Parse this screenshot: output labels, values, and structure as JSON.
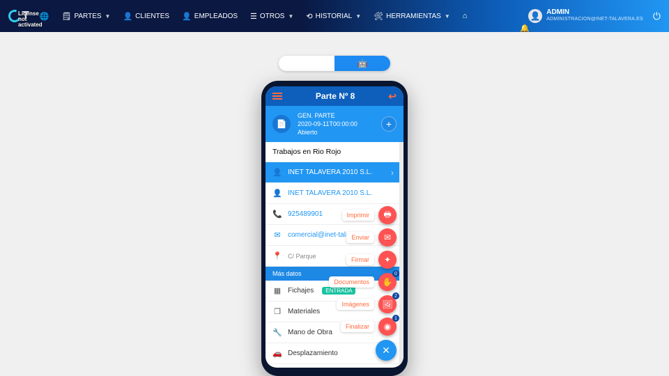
{
  "license_overlay": "License not\nactivated",
  "logo_suffix": "T",
  "nav": {
    "partes": "PARTES",
    "clientes": "CLIENTES",
    "empleados": "EMPLEADOS",
    "otros": "OTROS",
    "historial": "HISTORIAL",
    "herramientas": "HERRAMIENTAS"
  },
  "user": {
    "name": "ADMIN",
    "email": "ADMINISTRACION@INET-TALAVERA.ES"
  },
  "app": {
    "title": "Parte Nº 8",
    "gen_label": "GEN. PARTE",
    "gen_date": "2020-09-11T00:00:00",
    "gen_status": "Abierto",
    "description": "Trabajos en Rio Rojo",
    "company1": "INET TALAVERA 2010 S.L.",
    "company2": "INET TALAVERA 2010 S.L.",
    "phone": "925489901",
    "email": "comercial@inet-talavera.es",
    "address": "C/ Parque",
    "more_header": "Más datos",
    "fichajes": "Fichajes",
    "entrada_tag": "ENTRADA",
    "materiales": "Materiales",
    "mano": "Mano de Obra",
    "desplaz": "Desplazamiento"
  },
  "fab": {
    "imprimir": "Imprimir",
    "enviar": "Enviar",
    "firmar": "Firmar",
    "documentos": "Documentos",
    "imagenes": "Imágenes",
    "finalizar": "Finalizar",
    "badge_docs": "0",
    "badge_imgs": "2",
    "badge_fin": "1"
  }
}
